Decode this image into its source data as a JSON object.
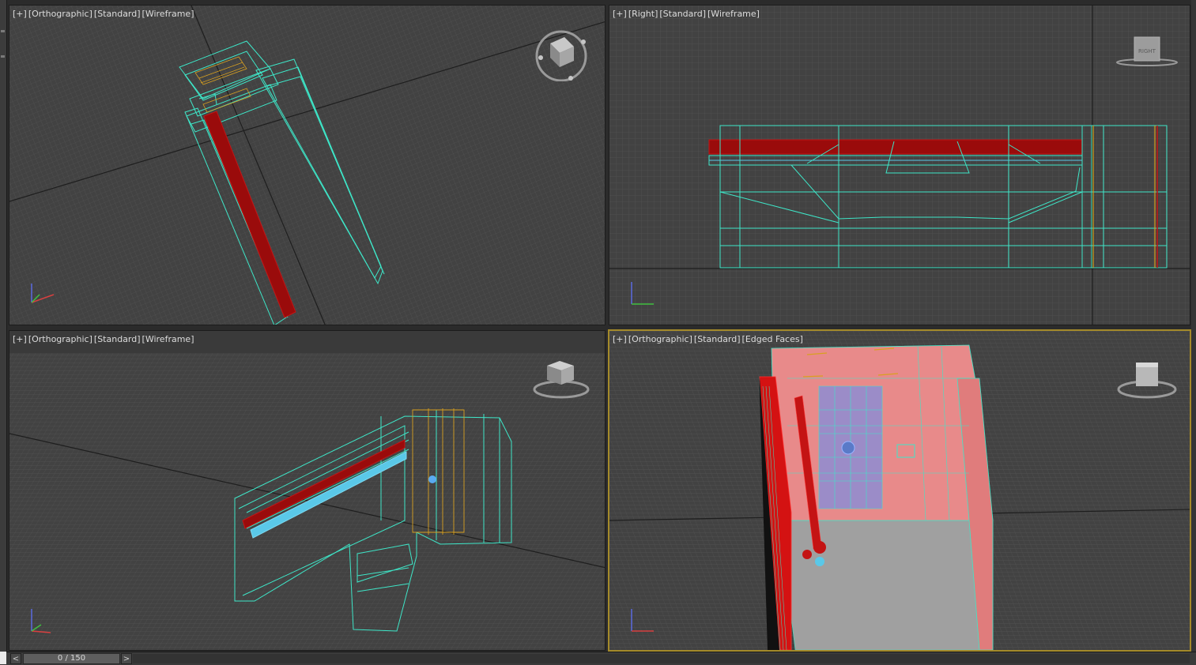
{
  "viewports": {
    "top_left": {
      "label_plus": "[+]",
      "label_view": "[Orthographic]",
      "label_shading": "[Standard]",
      "label_mode": "[Wireframe]"
    },
    "top_right": {
      "label_plus": "[+]",
      "label_view": "[Right]",
      "label_shading": "[Standard]",
      "label_mode": "[Wireframe]",
      "viewcube_face": "RIGHT"
    },
    "bottom_left": {
      "label_plus": "[+]",
      "label_view": "[Orthographic]",
      "label_shading": "[Standard]",
      "label_mode": "[Wireframe]"
    },
    "bottom_right": {
      "label_plus": "[+]",
      "label_view": "[Orthographic]",
      "label_shading": "[Standard]",
      "label_mode": "[Edged Faces]",
      "active": true
    }
  },
  "timeline": {
    "prev_label": "<",
    "next_label": ">",
    "frame_display": "0 / 150",
    "current_frame": 0,
    "total_frames": 150
  },
  "colors": {
    "viewport_bg": "#424242",
    "grid": "#555555",
    "wire_cyan": "#3ee6c8",
    "wire_red": "#b01010",
    "wire_orange": "#d8a020",
    "selection_blue": "#5ac8e8",
    "active_border": "#a48a2a",
    "face_pink": "#e88a8a",
    "face_violet": "#9b8cc8"
  },
  "icons": [
    "viewcube-icon",
    "axis-tripod-icon"
  ]
}
